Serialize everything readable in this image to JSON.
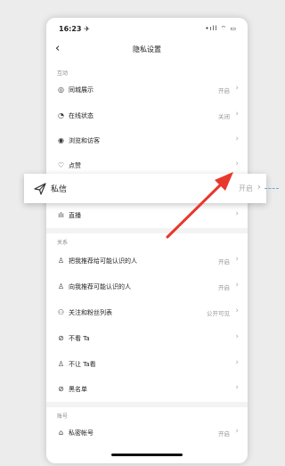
{
  "status_bar": {
    "time": "16:23 ✈",
    "icons": "•ıll ⌔ ▭"
  },
  "nav": {
    "back": "‹",
    "title": "隐私设置"
  },
  "sections": {
    "interaction": "互动",
    "relations": "关系",
    "account": "账号"
  },
  "rows": {
    "local_display": {
      "icon": "location-icon",
      "label": "同城展示",
      "value": "开启"
    },
    "online_status": {
      "icon": "online-icon",
      "label": "在线状态",
      "value": "关闭"
    },
    "browse_visit": {
      "icon": "eye-icon",
      "label": "浏览和访客",
      "value": ""
    },
    "likes": {
      "icon": "heart-icon",
      "label": "点赞",
      "value": ""
    },
    "live": {
      "icon": "live-icon",
      "label": "直播",
      "value": ""
    },
    "recommend_me": {
      "icon": "recommend-icon",
      "label": "把我推荐给可能认识的人",
      "value": "开启"
    },
    "recommend_to_me": {
      "icon": "recommend-icon",
      "label": "向我推荐可能认识的人",
      "value": "开启"
    },
    "follow_fans": {
      "icon": "users-icon",
      "label": "关注和粉丝列表",
      "value": "公开可见"
    },
    "hide_ta": {
      "icon": "hide-icon",
      "label": "不看 Ta",
      "value": ""
    },
    "block_ta": {
      "icon": "block-user-icon",
      "label": "不让 Ta看",
      "value": ""
    },
    "blacklist": {
      "icon": "ban-icon",
      "label": "黑名单",
      "value": ""
    },
    "private_account": {
      "icon": "lock-icon",
      "label": "私密帐号",
      "value": "开启"
    }
  },
  "highlight": {
    "icon": "send-icon",
    "label": "私信",
    "value": "开启",
    "chevron": "›"
  },
  "chevron": "›",
  "colors": {
    "arrow": "#e8372c",
    "dash": "#7fa0d8"
  }
}
